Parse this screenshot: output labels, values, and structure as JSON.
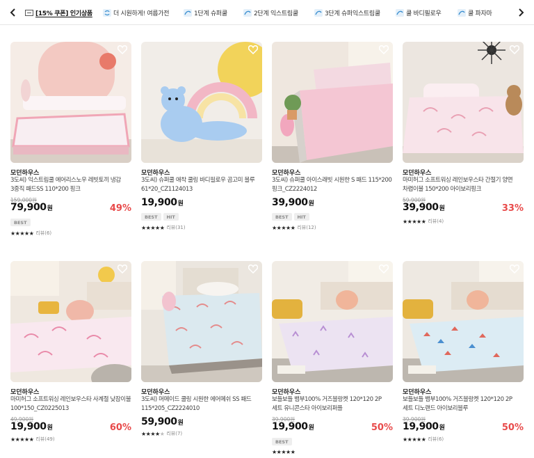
{
  "tabbar": {
    "tabs": [
      {
        "label": "[15% 쿠폰] 인기상품",
        "active": true,
        "icon": "coupon-icon"
      },
      {
        "label": "더 시원하게! 여름가전",
        "active": false,
        "icon": "fan-icon"
      },
      {
        "label": "1단계 슈퍼쿨",
        "active": false,
        "icon": "cool-wave-icon"
      },
      {
        "label": "2단계 익스트림쿨",
        "active": false,
        "icon": "cool-wave-icon"
      },
      {
        "label": "3단계 슈퍼익스트림쿨",
        "active": false,
        "icon": "cool-wave-icon"
      },
      {
        "label": "쿨 바디필로우",
        "active": false,
        "icon": "cool-wave-icon"
      },
      {
        "label": "쿨 파자마",
        "active": false,
        "icon": "cool-wave-icon"
      }
    ]
  },
  "products": [
    {
      "brand": "모던하우스",
      "title": "3도씨) 익스트림쿨 에어리스노우 레빗토끼 냉감 3중직 패드SS 110*200 핑크",
      "original_price": "159,000원",
      "price": "79,900",
      "currency": "원",
      "discount": "49%",
      "badges": [
        "BEST"
      ],
      "stars": 5,
      "review": "리뷰(6)"
    },
    {
      "brand": "모던하우스",
      "title": "3도씨) 슈퍼쿨 애착 쿨링 바디필로우 곰고미 블루 61*20_CZ1124013",
      "original_price": "",
      "price": "19,900",
      "currency": "원",
      "discount": "",
      "badges": [
        "BEST",
        "HIT"
      ],
      "stars": 5,
      "review": "리뷰(31)"
    },
    {
      "brand": "모던하우스",
      "title": "3도씨) 슈퍼쿨 아이스래빗 시원한 S 패드 115*200 핑크_CZ2224012",
      "original_price": "",
      "price": "39,900",
      "currency": "원",
      "discount": "",
      "badges": [
        "BEST",
        "HIT"
      ],
      "stars": 5,
      "review": "리뷰(12)"
    },
    {
      "brand": "모던하우스",
      "title": "마미허그 소프트워싱 레인보우스타 간절기 양면 차렵이불 150*200 아이보리핑크",
      "original_price": "59,900원",
      "price": "39,900",
      "currency": "원",
      "discount": "33%",
      "badges": [],
      "stars": 5,
      "review": "리뷰(4)"
    },
    {
      "brand": "모던하우스",
      "title": "마미허그 소프트워싱 레인보우스타 사계절 낮잠이불 100*150_CZ0225013",
      "original_price": "49,900원",
      "price": "19,900",
      "currency": "원",
      "discount": "60%",
      "badges": [],
      "stars": 5,
      "review": "리뷰(49)"
    },
    {
      "brand": "모던하우스",
      "title": "3도씨) 머메이드 쿨링 시원한 에어메쉬 SS 패드 115*205_CZ2224010",
      "original_price": "",
      "price": "59,900",
      "currency": "원",
      "discount": "",
      "badges": [],
      "stars": 4,
      "review": "리뷰(7)"
    },
    {
      "brand": "모던하우스",
      "title": "보들보들 뱀부100% 거즈블랑켓 120*120 2P 세트 유니콘스타 아이보리퍼플",
      "original_price": "39,900원",
      "price": "19,900",
      "currency": "원",
      "discount": "50%",
      "badges": [
        "BEST"
      ],
      "stars": 5,
      "review": ""
    },
    {
      "brand": "모던하우스",
      "title": "보들보들 뱀부100% 거즈블랑켓 120*120 2P 세트 디노랜드 아이보리블루",
      "original_price": "39,900원",
      "price": "19,900",
      "currency": "원",
      "discount": "50%",
      "badges": [],
      "stars": 5,
      "review": "리뷰(6)"
    }
  ],
  "colors": {
    "discount": "#e84a4a",
    "price": "#111111",
    "badge_bg": "#eeeeee",
    "divider": "#e6e6e6"
  }
}
